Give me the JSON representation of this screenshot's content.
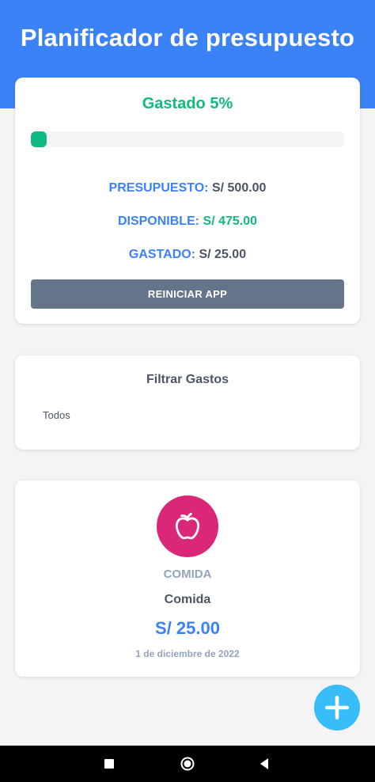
{
  "header": {
    "title": "Planificador de presupuesto"
  },
  "budget": {
    "spent_title": "Gastado 5%",
    "progress_percent": 5,
    "budget_label": "PRESUPUESTO:",
    "budget_value": "S/ 500.00",
    "available_label": "DISPONIBLE:",
    "available_value": "S/ 475.00",
    "spent_label": "GASTADO:",
    "spent_value": "S/ 25.00",
    "reset_label": "REINICIAR APP"
  },
  "filter": {
    "title": "Filtrar Gastos",
    "selected": "Todos"
  },
  "expenses": [
    {
      "icon": "apple-icon",
      "category": "COMIDA",
      "name": "Comida",
      "amount": "S/ 25.00",
      "date": "1 de diciembre de 2022"
    }
  ],
  "fab": {
    "icon": "plus-icon"
  },
  "navbar": {
    "icons": [
      "recents-square-icon",
      "home-circle-icon",
      "back-triangle-icon"
    ]
  },
  "colors": {
    "header": "#3b82f6",
    "accent_green": "#10b981",
    "category_food": "#db2777",
    "fab": "#38bdf8",
    "reset_button": "#64748b"
  }
}
